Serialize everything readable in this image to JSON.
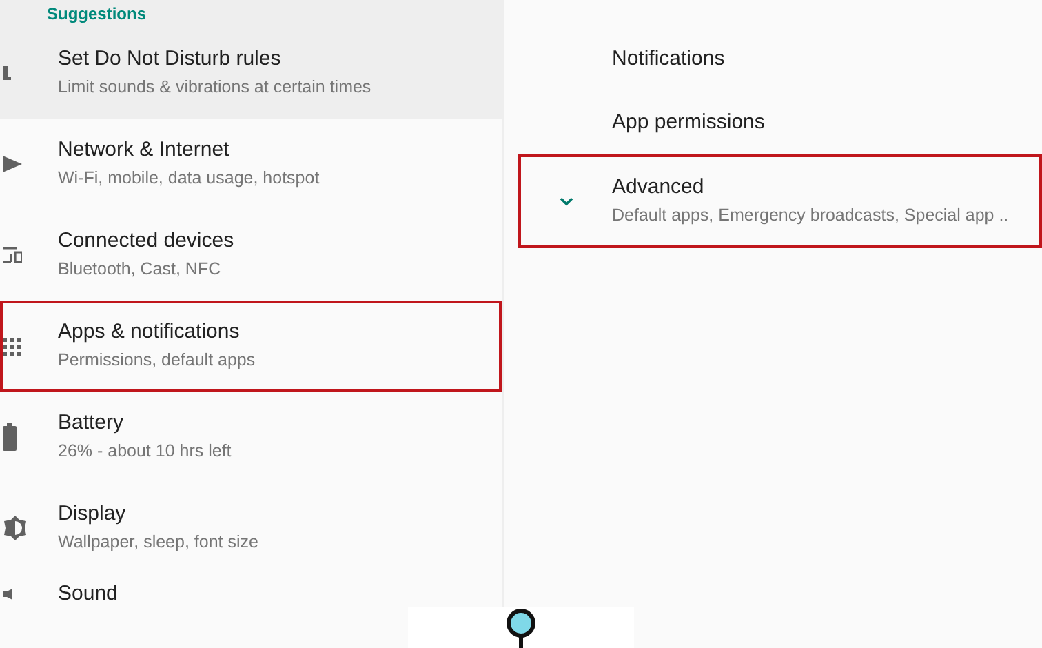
{
  "left_panel": {
    "section_header": "Suggestions",
    "items": [
      {
        "kind": "suggestion",
        "title": "Set Do Not Disturb rules",
        "subtitle": "Limit sounds & vibrations at certain times",
        "highlighted": false
      },
      {
        "kind": "setting",
        "title": "Network & Internet",
        "subtitle": "Wi-Fi, mobile, data usage, hotspot",
        "highlighted": false
      },
      {
        "kind": "setting",
        "title": "Connected devices",
        "subtitle": "Bluetooth, Cast, NFC",
        "highlighted": false
      },
      {
        "kind": "setting",
        "title": "Apps & notifications",
        "subtitle": "Permissions, default apps",
        "highlighted": true
      },
      {
        "kind": "setting",
        "title": "Battery",
        "subtitle": "26% - about 10 hrs left",
        "highlighted": false
      },
      {
        "kind": "setting",
        "title": "Display",
        "subtitle": "Wallpaper, sleep, font size",
        "highlighted": false
      },
      {
        "kind": "setting",
        "title": "Sound",
        "highlighted": false
      }
    ]
  },
  "right_panel": {
    "items": [
      {
        "kind": "plain",
        "title": "Notifications",
        "highlighted": false
      },
      {
        "kind": "plain",
        "title": "App permissions",
        "highlighted": false
      },
      {
        "kind": "expandable",
        "title": "Advanced",
        "subtitle": "Default apps, Emergency broadcasts, Special app ..",
        "expanded": false,
        "highlighted": true
      }
    ]
  }
}
